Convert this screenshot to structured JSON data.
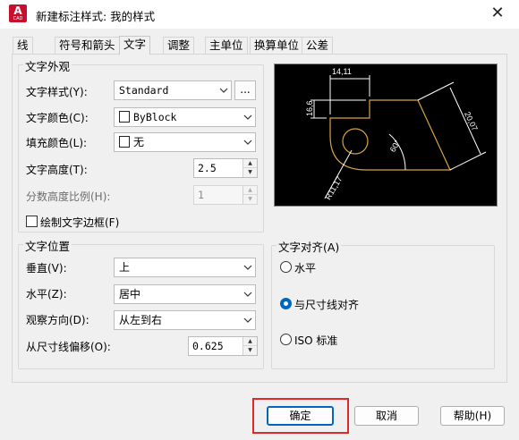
{
  "window": {
    "app_icon_letter": "A",
    "app_icon_caption": "CAD",
    "title": "新建标注样式: 我的样式",
    "close_glyph": "✕"
  },
  "tabs": [
    {
      "label": "线",
      "active": false
    },
    {
      "label": "符号和箭头",
      "active": false
    },
    {
      "label": "文字",
      "active": true
    },
    {
      "label": "调整",
      "active": false
    },
    {
      "label": "主单位",
      "active": false
    },
    {
      "label": "换算单位",
      "active": false
    },
    {
      "label": "公差",
      "active": false
    }
  ],
  "text_appearance": {
    "group_title": "文字外观",
    "style_label": "文字样式(Y):",
    "style_value": "Standard",
    "style_button": "...",
    "color_label": "文字颜色(C):",
    "color_value": "ByBlock",
    "fill_label": "填充颜色(L):",
    "fill_value": "无",
    "height_label": "文字高度(T):",
    "height_value": "2.5",
    "fraction_label": "分数高度比例(H):",
    "fraction_value": "1",
    "frame_label": "绘制文字边框(F)",
    "frame_checked": false
  },
  "preview": {
    "dim_top": "14,11",
    "dim_left": "16,6",
    "dim_right": "20,07",
    "dim_angle": "60°",
    "dim_radius": "R11,17",
    "line_color": "#ffffff",
    "geometry_color": "#d8a441"
  },
  "text_placement": {
    "group_title": "文字位置",
    "vertical_label": "垂直(V):",
    "vertical_value": "上",
    "horizontal_label": "水平(Z):",
    "horizontal_value": "居中",
    "view_dir_label": "观察方向(D):",
    "view_dir_value": "从左到右",
    "offset_label": "从尺寸线偏移(O):",
    "offset_value": "0.625"
  },
  "text_alignment": {
    "group_title": "文字对齐(A)",
    "options": [
      {
        "label": "水平",
        "checked": false
      },
      {
        "label": "与尺寸线对齐",
        "checked": true
      },
      {
        "label": "ISO 标准",
        "checked": false
      }
    ]
  },
  "buttons": {
    "ok": "确定",
    "cancel": "取消",
    "help": "帮助(H)"
  },
  "colors": {
    "accent": "#0067c0",
    "highlight": "#e0292c",
    "app_icon": "#c8102e"
  }
}
